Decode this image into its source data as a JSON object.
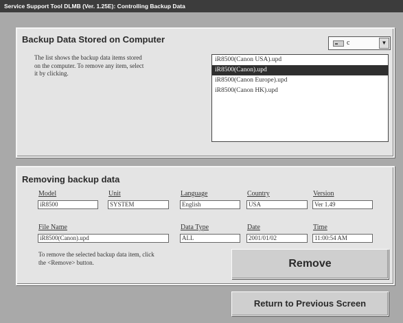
{
  "window": {
    "title": "Service Support Tool DLMB (Ver. 1.25E): Controlling Backup Data"
  },
  "backup_panel": {
    "title": "Backup Data Stored on Computer",
    "description_lines": [
      "The list shows the backup data items stored",
      "on the computer. To remove any item, select",
      "it by clicking."
    ],
    "drive_value": "c",
    "items": [
      "iR8500(Canon USA).upd",
      "iR8500(Canon).upd",
      "iR8500(Canon Europe).upd",
      "iR8500(Canon HK).upd"
    ],
    "selected_index": 1
  },
  "remove_panel": {
    "title": "Removing backup data",
    "fields": {
      "model": {
        "label": "Model",
        "value": "iR8500"
      },
      "unit": {
        "label": "Unit",
        "value": "SYSTEM"
      },
      "language": {
        "label": "Language",
        "value": "English"
      },
      "country": {
        "label": "Country",
        "value": "USA"
      },
      "version": {
        "label": "Version",
        "value": "Ver 1.49"
      },
      "file_name": {
        "label": "File Name",
        "value": "iR8500(Canon).upd"
      },
      "data_type": {
        "label": "Data Type",
        "value": "ALL"
      },
      "date": {
        "label": "Date",
        "value": "2001/01/02"
      },
      "time": {
        "label": "Time",
        "value": "11:00:54 AM"
      }
    },
    "instruction_lines": [
      "To remove the selected backup data item, click",
      "the <Remove> button."
    ],
    "remove_button": "Remove"
  },
  "footer": {
    "return_button": "Return to Previous Screen"
  }
}
